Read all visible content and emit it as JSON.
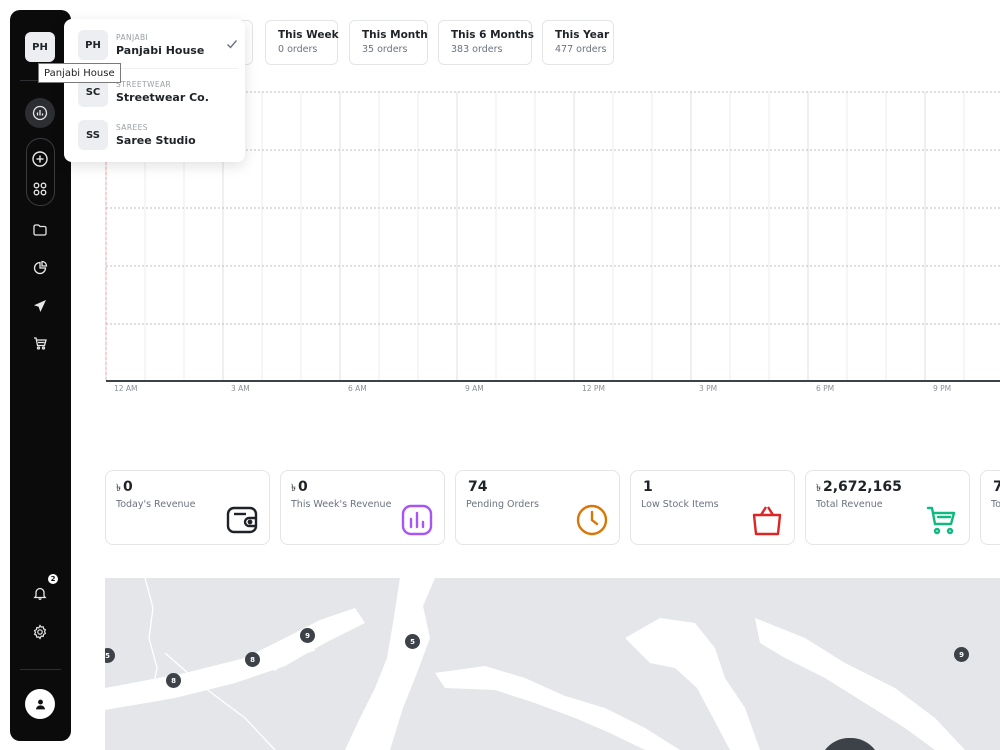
{
  "sidebar": {
    "store_abbr": "PH",
    "notification_count": "2",
    "icons": [
      "analytics-icon",
      "plus-icon",
      "apps-grid-icon",
      "folder-icon",
      "pie-chart-icon",
      "send-icon",
      "cart-icon",
      "bell-icon",
      "gear-icon",
      "user-icon"
    ]
  },
  "tooltip": {
    "text": "Panjabi House"
  },
  "store_dropdown": {
    "items": [
      {
        "abbr": "PH",
        "category": "PANJABI",
        "name": "Panjabi House",
        "selected": true
      },
      {
        "abbr": "SC",
        "category": "STREETWEAR",
        "name": "Streetwear Co.",
        "selected": false
      },
      {
        "abbr": "SS",
        "category": "SAREES",
        "name": "Saree Studio",
        "selected": false
      }
    ]
  },
  "periods": [
    {
      "title": "This Week",
      "sub": "0 orders"
    },
    {
      "title": "This Month",
      "sub": "35 orders"
    },
    {
      "title": "This 6 Months",
      "sub": "383 orders"
    },
    {
      "title": "This Year",
      "sub": "477 orders"
    }
  ],
  "chart_data": {
    "type": "line",
    "x_ticks": [
      "12 AM",
      "3 AM",
      "6 AM",
      "9 AM",
      "12 PM",
      "3 PM",
      "6 PM",
      "9 PM"
    ],
    "series": [],
    "grid": true
  },
  "stats": [
    {
      "currency": "৳",
      "value": "0",
      "label": "Today's Revenue",
      "icon": "wallet-icon",
      "color": "#1f2328"
    },
    {
      "currency": "৳",
      "value": "0",
      "label": "This Week's Revenue",
      "icon": "bar-chart-icon",
      "color": "#a855f7"
    },
    {
      "currency": "",
      "value": "74",
      "label": "Pending Orders",
      "icon": "clock-icon",
      "color": "#d97706"
    },
    {
      "currency": "",
      "value": "1",
      "label": "Low Stock Items",
      "icon": "shopping-bag-icon",
      "color": "#dc2626"
    },
    {
      "currency": "৳",
      "value": "2,672,165",
      "label": "Total Revenue",
      "icon": "cart-icon",
      "color": "#10b981"
    },
    {
      "currency": "",
      "value": "7",
      "label": "To",
      "icon": "",
      "color": "#1f2328"
    }
  ],
  "map": {
    "markers": [
      "5",
      "9",
      "5",
      "8",
      "8",
      "9"
    ]
  }
}
